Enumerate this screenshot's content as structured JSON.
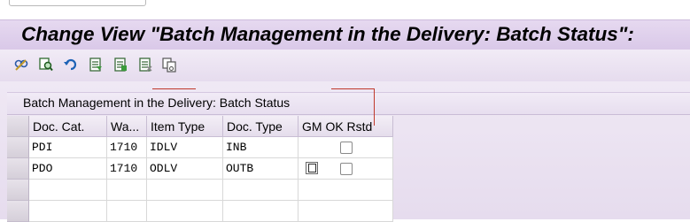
{
  "window": {
    "title": "Change View \"Batch Management in the Delivery: Batch Status\":"
  },
  "toolbar": {
    "buttons": [
      {
        "icon": "display-change-icon"
      },
      {
        "icon": "find-icon"
      },
      {
        "icon": "undo-icon"
      },
      {
        "icon": "select-all-icon"
      },
      {
        "icon": "select-block-icon"
      },
      {
        "icon": "deselect-all-icon"
      },
      {
        "icon": "copy-as-icon"
      }
    ]
  },
  "table": {
    "title": "Batch Management in the Delivery: Batch Status",
    "columns": [
      "Doc. Cat.",
      "Wa...",
      "Item Type",
      "Doc. Type",
      "GM OK Rstd"
    ],
    "rows": [
      {
        "doc_cat": "PDI",
        "wa": "1710",
        "item_type": "IDLV",
        "doc_type": "INB",
        "gm_ok_rstd": false
      },
      {
        "doc_cat": "PDO",
        "wa": "1710",
        "item_type": "ODLV",
        "doc_type": "OUTB",
        "gm_ok_rstd": false
      }
    ]
  },
  "colors": {
    "title_bg": "#d9c8e8",
    "annotation": "#c0392b"
  }
}
